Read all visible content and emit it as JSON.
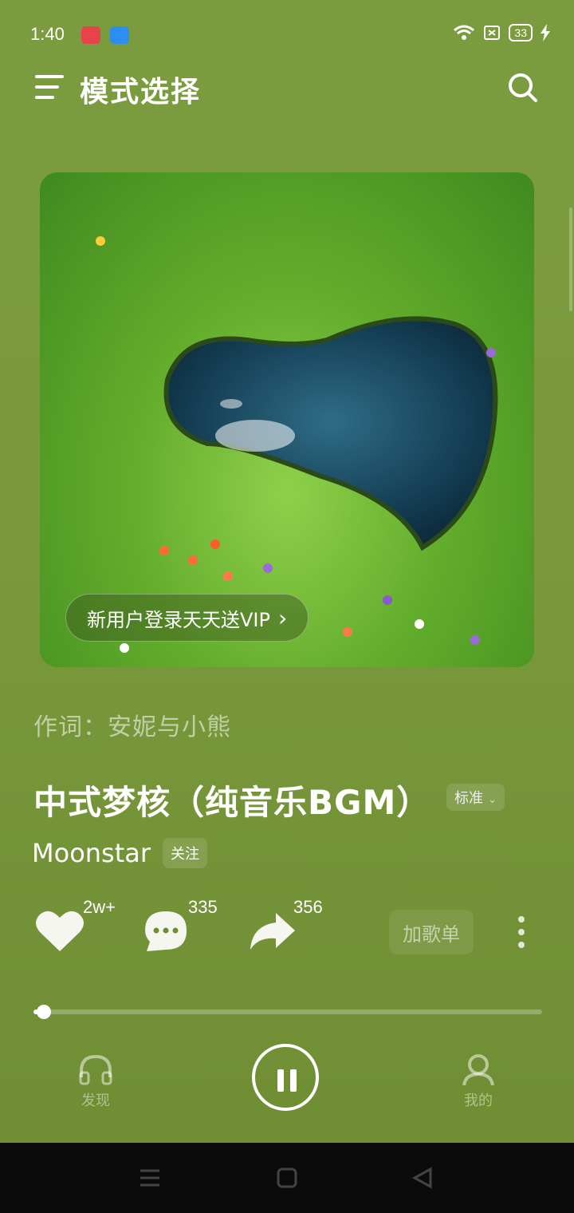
{
  "status_bar": {
    "time": "1:40",
    "battery": "33"
  },
  "header": {
    "title": "模式选择"
  },
  "cover": {
    "promo_text": "新用户登录天天送VIP",
    "promo_arrow": "›"
  },
  "song": {
    "lyricist": "作词：安妮与小熊",
    "title": "中式梦核（纯音乐BGM）",
    "quality": "标准",
    "quality_arrow": "⌄",
    "artist": "Moonstar",
    "follow": "关注"
  },
  "actions": {
    "like_count": "2w+",
    "comment_count": "335",
    "share_count": "356",
    "add_playlist": "加歌单"
  },
  "player": {
    "progress": 0.02
  },
  "bottom_nav": {
    "discover": "发现",
    "mine": "我的"
  },
  "colors": {
    "background": "#7a9c3f",
    "accent": "#ffffff"
  }
}
